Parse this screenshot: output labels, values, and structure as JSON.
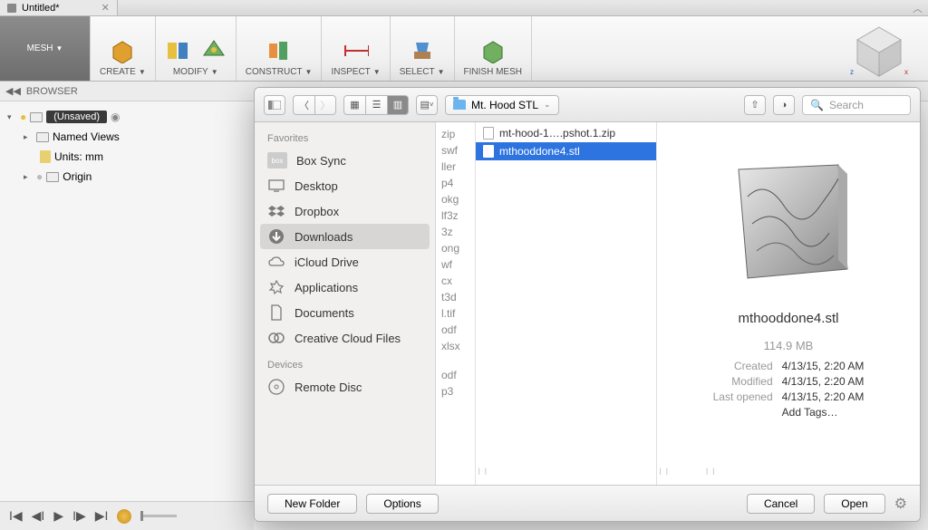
{
  "tab": {
    "title": "Untitled*"
  },
  "ribbon": {
    "mesh": "MESH",
    "create": "CREATE",
    "modify": "MODIFY",
    "construct": "CONSTRUCT",
    "inspect": "INSPECT",
    "select": "SELECT",
    "finish": "FINISH MESH"
  },
  "browser": {
    "title": "BROWSER",
    "root": "(Unsaved)",
    "named_views": "Named Views",
    "units": "Units: mm",
    "origin": "Origin"
  },
  "finder": {
    "path_label": "Mt. Hood STL",
    "search_placeholder": "Search",
    "sidebar": {
      "favorites_heading": "Favorites",
      "devices_heading": "Devices",
      "box_sync": "Box Sync",
      "desktop": "Desktop",
      "dropbox": "Dropbox",
      "downloads": "Downloads",
      "icloud": "iCloud Drive",
      "applications": "Applications",
      "documents": "Documents",
      "ccf": "Creative Cloud Files",
      "remote_disc": "Remote Disc"
    },
    "col1_frags": [
      "zip",
      "swf",
      "ller",
      "p4",
      "okg",
      "lf3z",
      "3z",
      "ong",
      "wf",
      "cx",
      "t3d",
      "l.tif",
      "odf",
      "xlsx",
      "odf",
      "p3"
    ],
    "files": {
      "zip": "mt-hood-1….pshot.1.zip",
      "stl": "mthooddone4.stl"
    },
    "preview": {
      "name": "mthooddone4.stl",
      "size": "114.9 MB",
      "created_k": "Created",
      "created_v": "4/13/15, 2:20 AM",
      "modified_k": "Modified",
      "modified_v": "4/13/15, 2:20 AM",
      "opened_k": "Last opened",
      "opened_v": "4/13/15, 2:20 AM",
      "add_tags": "Add Tags…"
    },
    "footer": {
      "new_folder": "New Folder",
      "options": "Options",
      "cancel": "Cancel",
      "open": "Open"
    }
  }
}
